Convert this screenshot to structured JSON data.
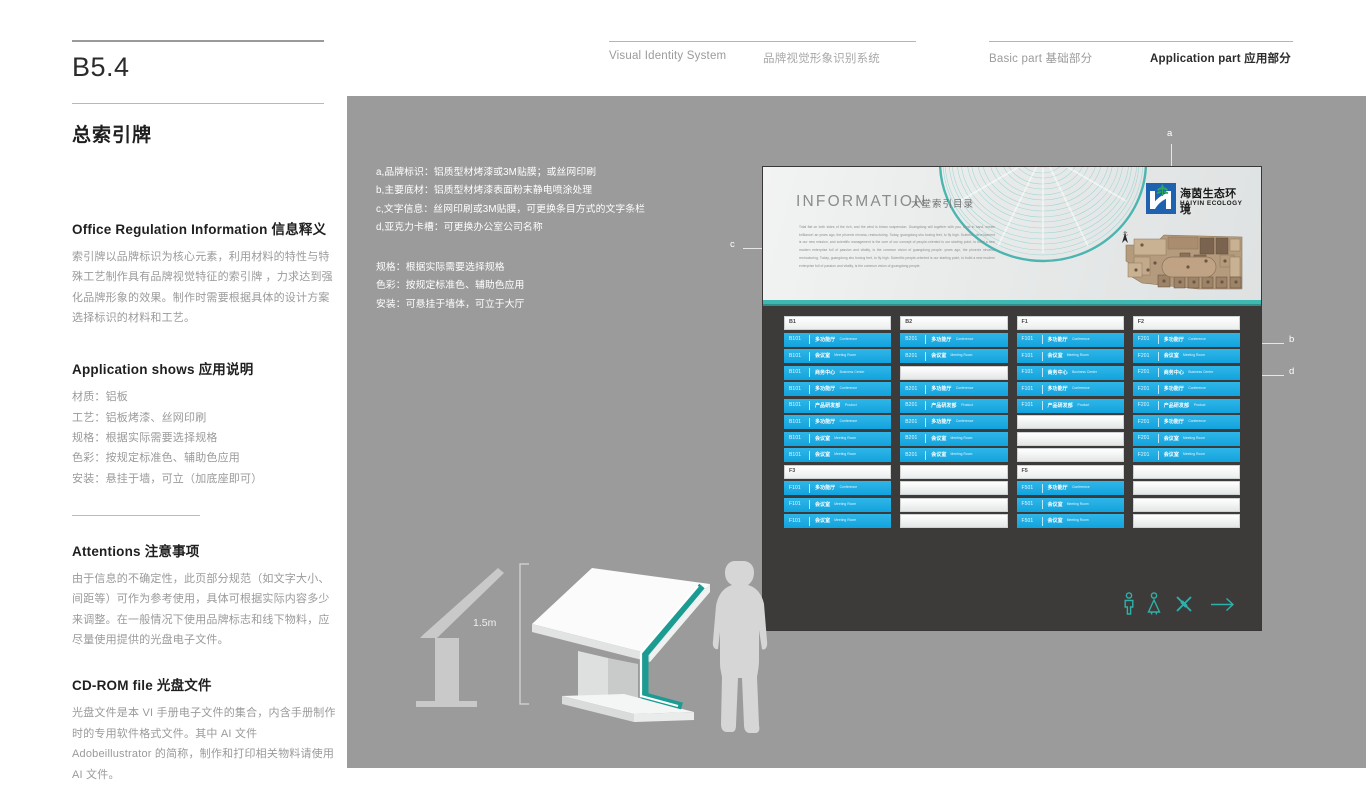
{
  "header": {
    "page_code": "B5.4",
    "sheet_title": "总索引牌",
    "nav": {
      "vis_en": "Visual Identity System",
      "vis_cn": "品牌视觉形象识别系统",
      "basic": "Basic part  基础部分",
      "application": "Application part  应用部分"
    }
  },
  "left": {
    "s1": {
      "heading": "Office Regulation Information 信息释义",
      "body": "索引牌以品牌标识为核心元素，利用材料的特性与特殊工艺制作具有品牌视觉特征的索引牌 ，力求达到强化品牌形象的效果。制作时需要根据具体的设计方案选择标识的材料和工艺。"
    },
    "s2": {
      "heading": "Application shows 应用说明",
      "lines": [
        "材质：铝板",
        "工艺：铝板烤漆、丝网印刷",
        "规格：根据实际需要选择规格",
        "色彩：按规定标准色、辅助色应用",
        "安装：悬挂于墙，可立（加底座即可）"
      ]
    },
    "s3": {
      "heading": "Attentions 注意事项",
      "body": "由于信息的不确定性，此页部分规范（如文字大小、间距等）可作为参考使用，具体可根据实际内容多少来调整。在一般情况下使用品牌标志和线下物料，应尽量使用提供的光盘电子文件。"
    },
    "s4": {
      "heading": "CD-ROM file 光盘文件",
      "body": "光盘文件是本 VI 手册电子文件的集合，内含手册制作时的专用软件格式文件。其中 AI 文件 Adobeillustrator 的简称，制作和打印相关物料请使用 AI 文件。"
    }
  },
  "stage": {
    "spec_parts": [
      "a,品牌标识：铝质型材烤漆或3M贴膜；或丝网印刷",
      "b,主要底材：铝质型材烤漆表面粉末静电喷涂处理",
      "c,文字信息：丝网印刷或3M贴膜，可更换条目方式的文字条栏",
      "d,亚克力卡槽：可更换办公室公司名称"
    ],
    "spec_meta": [
      "规格：根据实际需要选择规格",
      "色彩：按规定标准色、辅助色应用",
      "安装：可悬挂于墙体，可立于大厅"
    ],
    "callouts": {
      "a": "a",
      "b": "b",
      "c": "c",
      "d": "d"
    },
    "dimension": "1.5m"
  },
  "board": {
    "info_title": "INFORMATION",
    "info_title_cn": "大堂索引目录",
    "info_body": "Tidal flat on both sides of the rich, and the wind is blown suspension. Guangdong will together with you, hand in hand, create brilliance!  an years ago, the phoenix nirvana, restructuring. Today, guangdong shu boxing feet, to fly high. Scientific development is our new mission, and scientific management is the core of our concept of people-oriented is our starting point, to build a new modern enterprise full of passion and vitality, is the common vision of guangdong people.  years ago, the phoenix nirvana, restructuring. Today, guangdong shu boxing feet, to fly high. Scientific people-oriented is our starting point, to build a new modern enterprise full of passion and vitality, is the common vision of guangdong people.",
    "logo_cn": "海茵生态环境",
    "logo_en": "HAIYIN ECOLOGY",
    "compass": "北",
    "pictograms": [
      "male-restroom",
      "female-restroom",
      "dining",
      "arrow-right"
    ],
    "colors": {
      "item_blue": "#12a3dd",
      "teal_band": "#3fb8b2",
      "board_dark": "#3d3b39",
      "logo_blue": "#1f63b0"
    },
    "columns": [
      {
        "blocks": [
          {
            "group": "B1",
            "items": [
              {
                "room": "B101",
                "cn": "多功能厅",
                "en": "Conference"
              },
              {
                "room": "B101",
                "cn": "会议室",
                "en": "Meeting Room"
              },
              {
                "room": "B101",
                "cn": "商务中心",
                "en": "Business Center"
              },
              {
                "room": "B101",
                "cn": "多功能厅",
                "en": "Conference"
              },
              {
                "room": "B101",
                "cn": "产品研发部",
                "en": "Product"
              },
              {
                "room": "B101",
                "cn": "多功能厅",
                "en": "Conference"
              },
              {
                "room": "B101",
                "cn": "会议室",
                "en": "Meeting Room"
              },
              {
                "room": "B101",
                "cn": "会议室",
                "en": "Meeting Room"
              }
            ]
          },
          {
            "group": "F3",
            "items": [
              {
                "room": "F101",
                "cn": "多功能厅",
                "en": "Conference"
              },
              {
                "room": "F101",
                "cn": "会议室",
                "en": "Meeting Room"
              },
              {
                "room": "F101",
                "cn": "会议室",
                "en": "Meeting Room"
              }
            ]
          }
        ]
      },
      {
        "blocks": [
          {
            "group": "B2",
            "items": [
              {
                "room": "B201",
                "cn": "多功能厅",
                "en": "Conference"
              },
              {
                "room": "B201",
                "cn": "会议室",
                "en": "Meeting Room"
              },
              {
                "room": "",
                "cn": "",
                "en": ""
              },
              {
                "room": "B201",
                "cn": "多功能厅",
                "en": "Conference"
              },
              {
                "room": "B201",
                "cn": "产品研发部",
                "en": "Product"
              },
              {
                "room": "B201",
                "cn": "多功能厅",
                "en": "Conference"
              },
              {
                "room": "B201",
                "cn": "会议室",
                "en": "Meeting Room"
              },
              {
                "room": "B201",
                "cn": "会议室",
                "en": "Meeting Room"
              }
            ]
          },
          {
            "group": "",
            "items": [
              {
                "room": "",
                "cn": "",
                "en": ""
              },
              {
                "room": "",
                "cn": "",
                "en": ""
              },
              {
                "room": "",
                "cn": "",
                "en": ""
              }
            ]
          }
        ]
      },
      {
        "blocks": [
          {
            "group": "F1",
            "items": [
              {
                "room": "F101",
                "cn": "多功能厅",
                "en": "Conference"
              },
              {
                "room": "F101",
                "cn": "会议室",
                "en": "Meeting Room"
              },
              {
                "room": "F101",
                "cn": "商务中心",
                "en": "Business Center"
              },
              {
                "room": "F101",
                "cn": "多功能厅",
                "en": "Conference"
              },
              {
                "room": "F101",
                "cn": "产品研发部",
                "en": "Product"
              },
              {
                "room": "",
                "cn": "",
                "en": ""
              },
              {
                "room": "",
                "cn": "",
                "en": ""
              },
              {
                "room": "",
                "cn": "",
                "en": ""
              }
            ]
          },
          {
            "group": "F5",
            "items": [
              {
                "room": "F501",
                "cn": "多功能厅",
                "en": "Conference"
              },
              {
                "room": "F501",
                "cn": "会议室",
                "en": "Meeting Room"
              },
              {
                "room": "F501",
                "cn": "会议室",
                "en": "Meeting Room"
              }
            ]
          }
        ]
      },
      {
        "blocks": [
          {
            "group": "F2",
            "items": [
              {
                "room": "F201",
                "cn": "多功能厅",
                "en": "Conference"
              },
              {
                "room": "F201",
                "cn": "会议室",
                "en": "Meeting Room"
              },
              {
                "room": "F201",
                "cn": "商务中心",
                "en": "Business Center"
              },
              {
                "room": "F201",
                "cn": "多功能厅",
                "en": "Conference"
              },
              {
                "room": "F201",
                "cn": "产品研发部",
                "en": "Product"
              },
              {
                "room": "F201",
                "cn": "多功能厅",
                "en": "Conference"
              },
              {
                "room": "F201",
                "cn": "会议室",
                "en": "Meeting Room"
              },
              {
                "room": "F201",
                "cn": "会议室",
                "en": "Meeting Room"
              }
            ]
          },
          {
            "group": "",
            "items": [
              {
                "room": "",
                "cn": "",
                "en": ""
              },
              {
                "room": "",
                "cn": "",
                "en": ""
              },
              {
                "room": "",
                "cn": "",
                "en": ""
              }
            ]
          }
        ]
      }
    ]
  }
}
